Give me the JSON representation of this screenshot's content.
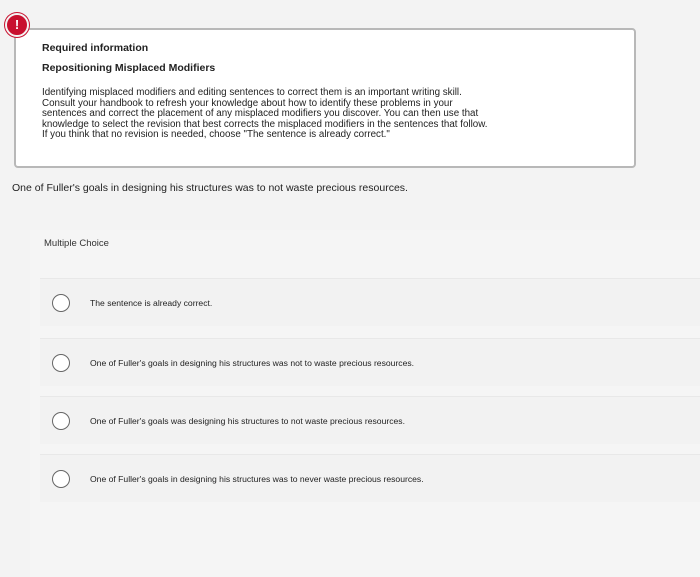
{
  "info": {
    "badge": "!",
    "heading": "Required information",
    "subheading": "Repositioning Misplaced Modifiers",
    "body_lines": [
      "Identifying misplaced modifiers and editing sentences to correct them is an important writing skill.",
      "Consult your handbook to refresh your knowledge about how to identify these problems in your",
      "sentences and correct the placement of any misplaced modifiers you discover. You can then use that",
      "knowledge to select the revision that best corrects the misplaced modifiers in the sentences that follow.",
      "If you think that no revision is needed, choose \"The sentence is already correct.\""
    ]
  },
  "question": {
    "text": "One of Fuller's goals in designing his structures was to not waste precious resources."
  },
  "multiple_choice": {
    "label": "Multiple Choice",
    "options": [
      {
        "text": "The sentence is already correct."
      },
      {
        "text": "One of Fuller's goals in designing his structures was not to waste precious resources."
      },
      {
        "text": "One of Fuller's goals was designing his structures to not waste precious resources."
      },
      {
        "text": "One of Fuller's goals in designing his structures was to never waste precious resources."
      }
    ]
  }
}
